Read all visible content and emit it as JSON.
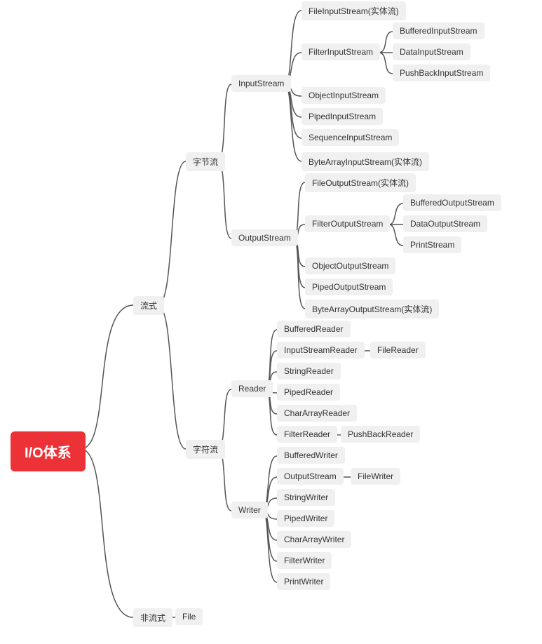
{
  "root": "I/O体系",
  "l1": {
    "stream": "流式",
    "nonstream": "非流式"
  },
  "l2": {
    "byte": "字节流",
    "char": "字符流",
    "file": "File"
  },
  "l3": {
    "input": "InputStream",
    "output": "OutputStream",
    "reader": "Reader",
    "writer": "Writer"
  },
  "input": {
    "file": "FileInputStream(实体流)",
    "filter": "FilterInputStream",
    "object": "ObjectInputStream",
    "piped": "PipedInputStream",
    "sequence": "SequenceInputStream",
    "bytearray": "ByteArrayInputStream(实体流)"
  },
  "filterInput": {
    "buffered": "BufferedInputStream",
    "data": "DataInputStream",
    "pushback": "PushBackInputStream"
  },
  "output": {
    "file": "FileOutputStream(实体流)",
    "filter": "FilterOutputStream",
    "object": "ObjectOutputStream",
    "piped": "PipedOutputStream",
    "bytearray": "ByteArrayOutputStream(实体流)"
  },
  "filterOutput": {
    "buffered": "BufferedOutputStream",
    "data": "DataOutputStream",
    "print": "PrintStream"
  },
  "reader": {
    "buffered": "BufferedReader",
    "inputstream": "InputStreamReader",
    "string": "StringReader",
    "piped": "PipedReader",
    "chararray": "CharArrayReader",
    "filter": "FilterReader"
  },
  "readerChild": {
    "filereader": "FileReader",
    "pushback": "PushBackReader"
  },
  "writer": {
    "buffered": "BufferedWriter",
    "outputstream": "OutputStream",
    "string": "StringWriter",
    "piped": "PipedWriter",
    "chararray": "CharArrayWriter",
    "filter": "FilterWriter",
    "print": "PrintWriter"
  },
  "writerChild": {
    "filewriter": "FileWriter"
  }
}
